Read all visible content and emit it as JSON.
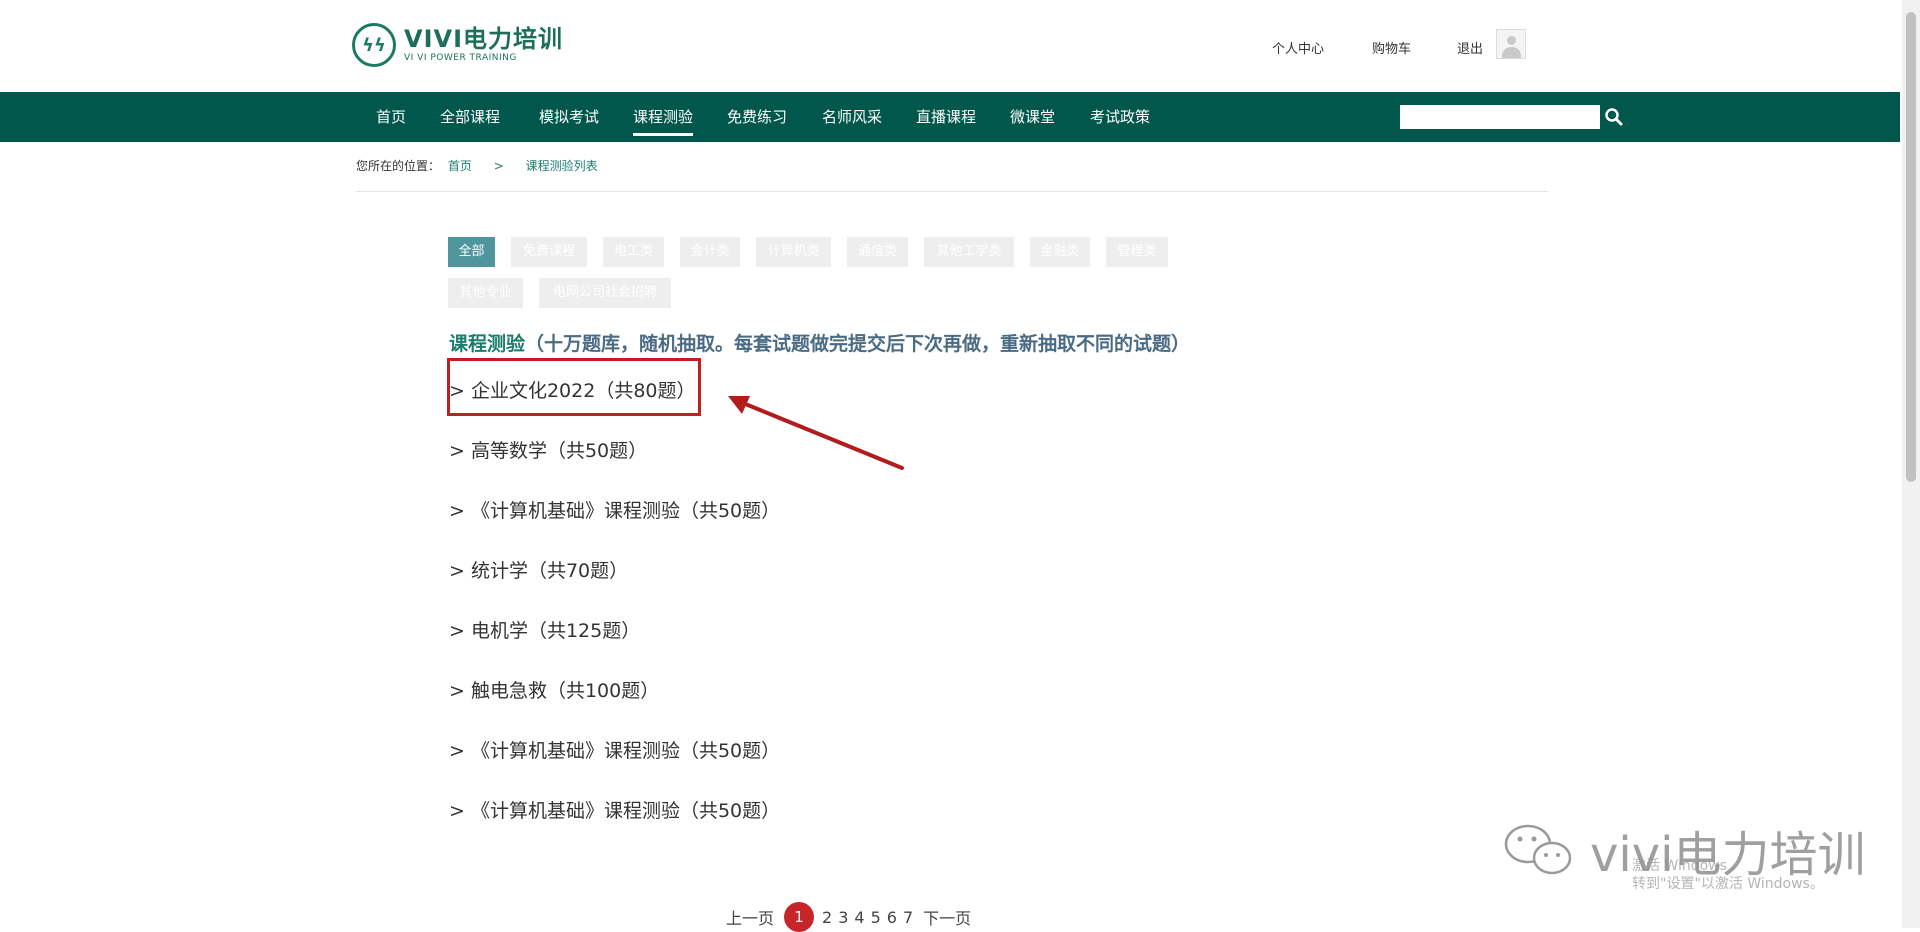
{
  "header": {
    "logo_title": "VIVI电力培训",
    "logo_subtitle": "VI VI POWER TRAINING",
    "links": [
      "个人中心",
      "购物车",
      "退出"
    ]
  },
  "nav": {
    "items": [
      "首页",
      "全部课程",
      "模拟考试",
      "课程测验",
      "免费练习",
      "名师风采",
      "直播课程",
      "微课堂",
      "考试政策"
    ],
    "active": "课程测验",
    "search_placeholder": ""
  },
  "breadcrumb": {
    "prefix": "您所在的位置：",
    "home": "首页",
    "separator": ">",
    "current": "课程测验列表"
  },
  "categories": [
    "全部",
    "免费课程",
    "电工类",
    "会计类",
    "计算机类",
    "通信类",
    "其他工学类",
    "金融类",
    "管理类",
    "其他专业",
    "电网公司社会招聘"
  ],
  "active_category": "全部",
  "section": {
    "title_highlight": "课程测验",
    "title_rest": "（十万题库，随机抽取。每套试题做完提交后下次再做，重新抽取不同的试题）"
  },
  "tests": [
    "> 企业文化2022（共80题）",
    "> 高等数学（共50题）",
    "> 《计算机基础》课程测验（共50题）",
    "> 统计学（共70题）",
    "> 电机学（共125题）",
    "> 触电急救（共100题）",
    "> 《计算机基础》课程测验（共50题）",
    "> 《计算机基础》课程测验（共50题）"
  ],
  "pager": {
    "prev": "上一页",
    "current": "1",
    "pages": [
      "2",
      "3",
      "4",
      "5",
      "6",
      "7"
    ],
    "next": "下一页"
  },
  "watermark": {
    "text": "vivi电力培训",
    "activate_line1": "激活 Windows",
    "activate_line2": "转到\"设置\"以激活 Windows。"
  },
  "colors": {
    "nav_bg": "#02574c",
    "accent": "#1b7d6c",
    "category_active": "#4f969c",
    "highlight_red": "#c01f1f"
  }
}
